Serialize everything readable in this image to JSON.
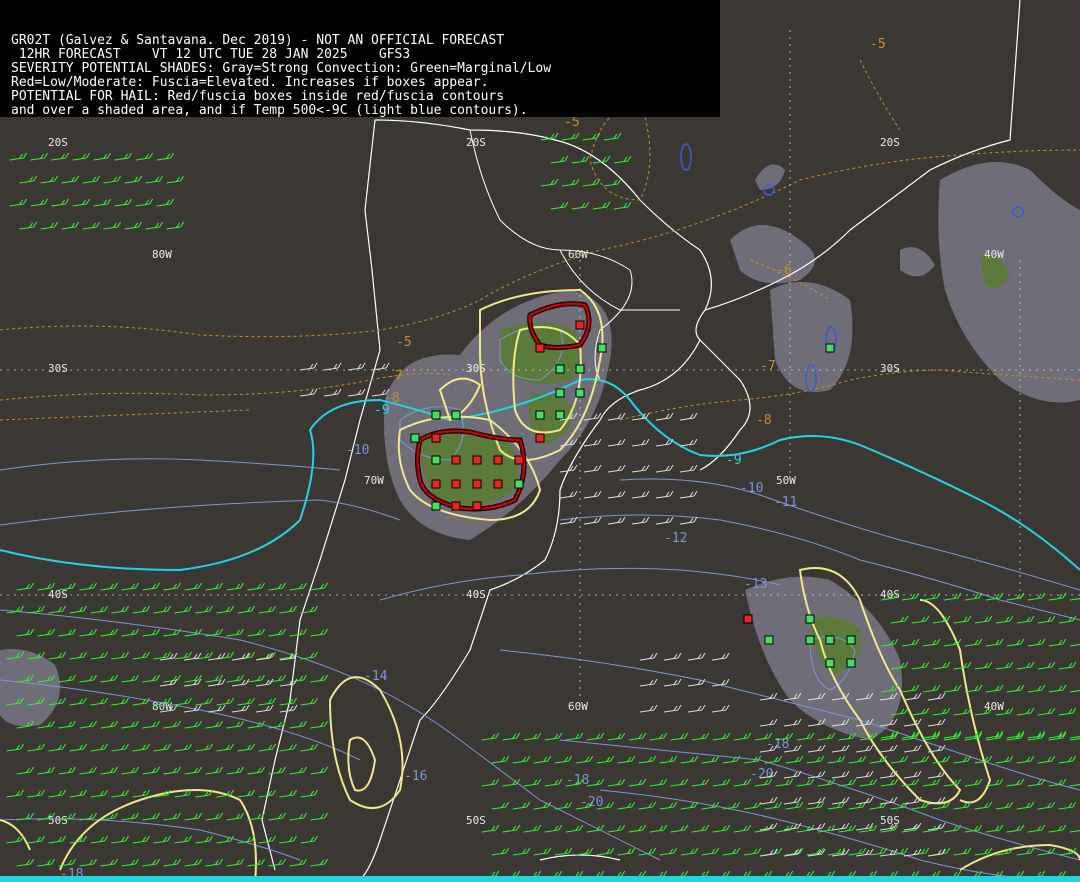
{
  "header": {
    "line1": "GR02T (Galvez & Santavana. Dec 2019) - NOT AN OFFICIAL FORECAST",
    "line2": " 12HR FORECAST    VT 12 UTC TUE 28 JAN 2025    GFS3",
    "line3": "SEVERITY POTENTIAL SHADES: Gray=Strong Convection: Green=Marginal/Low",
    "line4": "Red=Low/Moderate: Fuscia=Elevated. Increases if boxes appear.",
    "line5": "POTENTIAL FOR HAIL: Red/fuscia boxes inside red/fuscia contours",
    "line6": "and over a shaded area, and if Temp 500<-9C (light blue contours)."
  },
  "grid_labels": {
    "lat20_a": "20S",
    "lat20_b": "20S",
    "lat20_c": "20S",
    "lon80_a": "80W",
    "lon60_a": "60W",
    "lon40_a": "40W",
    "lat30_a": "30S",
    "lat30_b": "30S",
    "lat30_c": "30S",
    "lon70_a": "70W",
    "lon50_a": "50W",
    "lat40_a": "40S",
    "lat40_b": "40S",
    "lat40_c": "40S",
    "lon80_b": "80W",
    "lon60_b": "60W",
    "lon40_b": "40W",
    "lat50_a": "50S",
    "lat50_b": "50S",
    "lat50_c": "50S"
  },
  "contour_labels": {
    "orange": [
      "-5",
      "-5",
      "-5",
      "-6",
      "-7",
      "-7",
      "-8",
      "-8"
    ],
    "cyan": [
      "-9",
      "-9"
    ],
    "blue": [
      "-10",
      "-10",
      "-11",
      "-12",
      "-13",
      "-14",
      "-16",
      "-18",
      "-18",
      "-20",
      "-20",
      "-18"
    ]
  },
  "colors": {
    "background": "#3b3833",
    "coast": "#ffffff",
    "gray_shade": "#6f6e78",
    "green_shade": "#5c7a3a",
    "yellow_contour": "#f0e68c",
    "red_contour": "#cc0000",
    "cyan_contour": "#22d3e0",
    "blue_contour": "#7c95d6",
    "orange_contour": "#c98a2a",
    "wind_barb_green": "#33ee33",
    "wind_barb_white": "#dddddd"
  }
}
